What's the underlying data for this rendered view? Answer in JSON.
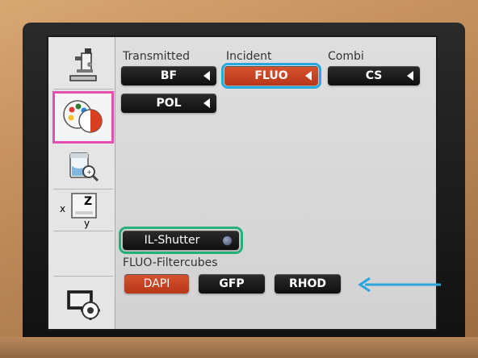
{
  "groups": {
    "transmitted": "Transmitted",
    "incident": "Incident",
    "combi": "Combi"
  },
  "buttons": {
    "bf": "BF",
    "fluo": "FLUO",
    "cs": "CS",
    "pol": "POL",
    "il_shutter": "IL-Shutter"
  },
  "filtercubes": {
    "label": "FLUO-Filtercubes",
    "dapi": "DAPI",
    "gfp": "GFP",
    "rhod": "RHOD"
  },
  "sidebar": {
    "xyz": {
      "x": "x",
      "y": "y",
      "z": "Z"
    }
  },
  "colors": {
    "active": "#c8431f",
    "button": "#1a1a1a",
    "highlight_pink": "#e24fb0",
    "highlight_blue": "#26a8e0",
    "highlight_green": "#24b07a",
    "arrow": "#2aa6dc"
  },
  "icons": [
    "microscope-icon",
    "color-palette-icon",
    "beaker-magnifier-icon",
    "xyz-stage-icon",
    "monitor-settings-icon"
  ]
}
